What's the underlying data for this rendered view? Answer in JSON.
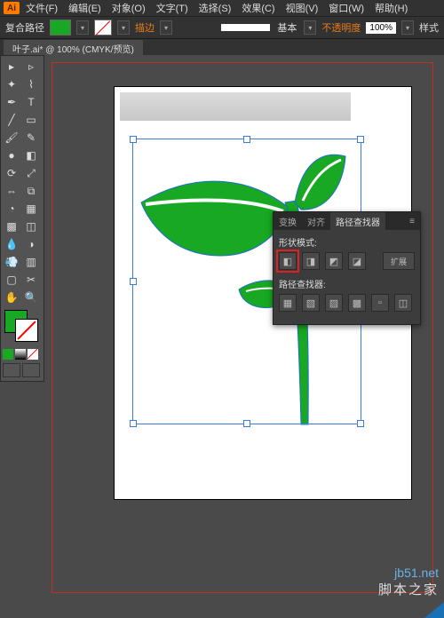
{
  "app_icon": "Ai",
  "menu": [
    "文件(F)",
    "编辑(E)",
    "对象(O)",
    "文字(T)",
    "选择(S)",
    "效果(C)",
    "视图(V)",
    "窗口(W)",
    "帮助(H)"
  ],
  "control": {
    "label": "复合路径",
    "fill_color": "#18a823",
    "stroke_label": "描边",
    "stroke_basic": "基本",
    "opacity_label": "不透明度",
    "opacity_value": "100%",
    "style_label": "样式"
  },
  "doc_tab": "叶子.ai* @ 100% (CMYK/预览)",
  "panel": {
    "tabs": [
      "变换",
      "对齐",
      "路径查找器"
    ],
    "active_tab": 2,
    "section1": "形状模式:",
    "expand": "扩展",
    "section2": "路径查找器:"
  },
  "watermark": {
    "url": "jb51.net",
    "text": "脚本之家"
  },
  "fill_color": "#18a823"
}
